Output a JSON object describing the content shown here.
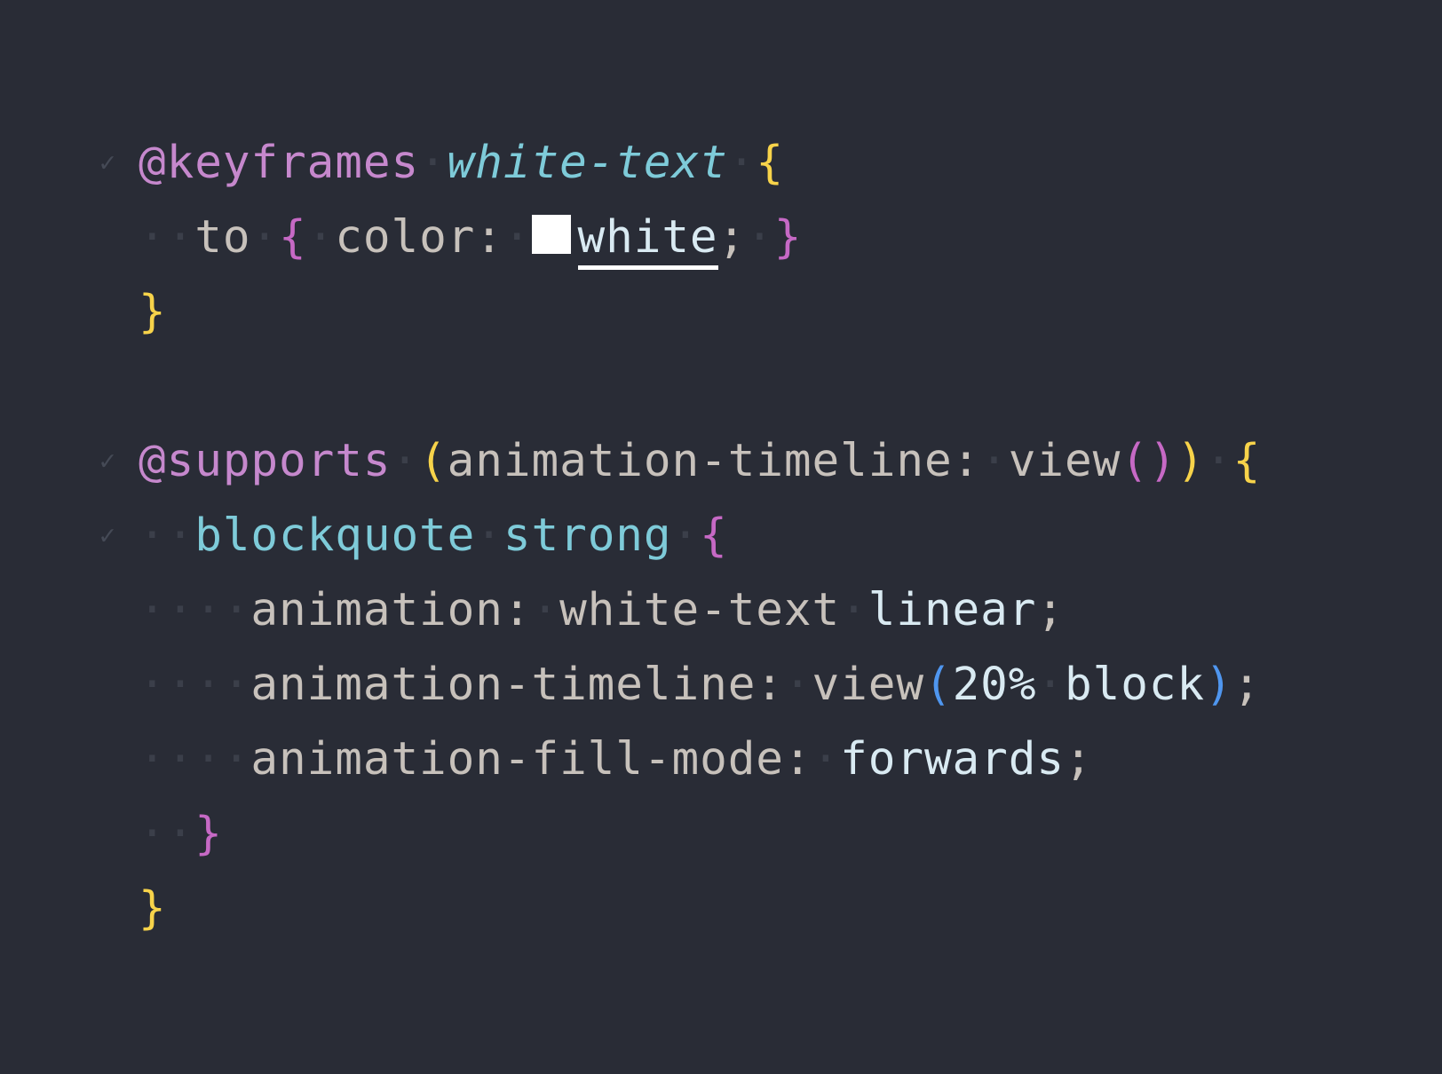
{
  "colors": {
    "background": "#292c36",
    "at_rule": "#c688cd",
    "name": "#7ecbd9",
    "brace_outer": "#f7d34a",
    "brace_inner": "#c669c5",
    "paren_blue": "#4f96ef",
    "property": "#c7c1bb",
    "value": "#d9eaf2",
    "punct": "#c7c1bb",
    "whitespace_marker": "#3b3f4a",
    "swatch": "#ffffff"
  },
  "icons": {
    "fold": "fold-check-icon",
    "swatch": "color-swatch-icon"
  },
  "lines": [
    {
      "fold": true,
      "tokens": [
        {
          "t": "@keyframes",
          "c": "at_rule"
        },
        {
          "t": "·",
          "c": "whitespace_marker"
        },
        {
          "t": "white-text",
          "c": "name",
          "italic": true
        },
        {
          "t": "·",
          "c": "whitespace_marker"
        },
        {
          "t": "{",
          "c": "brace_outer"
        }
      ]
    },
    {
      "fold": false,
      "tokens": [
        {
          "t": "··",
          "c": "whitespace_marker"
        },
        {
          "t": "to",
          "c": "property"
        },
        {
          "t": "·",
          "c": "whitespace_marker"
        },
        {
          "t": "{",
          "c": "brace_inner"
        },
        {
          "t": "·",
          "c": "whitespace_marker"
        },
        {
          "t": "color:",
          "c": "property"
        },
        {
          "t": "·",
          "c": "whitespace_marker"
        },
        {
          "swatch": true
        },
        {
          "t": "white",
          "c": "value",
          "underline": true
        },
        {
          "t": ";",
          "c": "punct"
        },
        {
          "t": "·",
          "c": "whitespace_marker"
        },
        {
          "t": "}",
          "c": "brace_inner"
        }
      ]
    },
    {
      "fold": false,
      "tokens": [
        {
          "t": "}",
          "c": "brace_outer"
        }
      ]
    },
    {
      "fold": false,
      "tokens": []
    },
    {
      "fold": true,
      "tokens": [
        {
          "t": "@supports",
          "c": "at_rule"
        },
        {
          "t": "·",
          "c": "whitespace_marker"
        },
        {
          "t": "(",
          "c": "brace_outer"
        },
        {
          "t": "animation-timeline:",
          "c": "property"
        },
        {
          "t": "·",
          "c": "whitespace_marker"
        },
        {
          "t": "view",
          "c": "property"
        },
        {
          "t": "()",
          "c": "brace_inner"
        },
        {
          "t": ")",
          "c": "brace_outer"
        },
        {
          "t": "·",
          "c": "whitespace_marker"
        },
        {
          "t": "{",
          "c": "brace_outer"
        }
      ]
    },
    {
      "fold": true,
      "tokens": [
        {
          "t": "··",
          "c": "whitespace_marker"
        },
        {
          "t": "blockquote",
          "c": "name"
        },
        {
          "t": "·",
          "c": "whitespace_marker"
        },
        {
          "t": "strong",
          "c": "name"
        },
        {
          "t": "·",
          "c": "whitespace_marker"
        },
        {
          "t": "{",
          "c": "brace_inner"
        }
      ]
    },
    {
      "fold": false,
      "tokens": [
        {
          "t": "····",
          "c": "whitespace_marker"
        },
        {
          "t": "animation:",
          "c": "property"
        },
        {
          "t": "·",
          "c": "whitespace_marker"
        },
        {
          "t": "white-text",
          "c": "property"
        },
        {
          "t": "·",
          "c": "whitespace_marker"
        },
        {
          "t": "linear",
          "c": "value"
        },
        {
          "t": ";",
          "c": "punct"
        }
      ]
    },
    {
      "fold": false,
      "tokens": [
        {
          "t": "····",
          "c": "whitespace_marker"
        },
        {
          "t": "animation-timeline:",
          "c": "property"
        },
        {
          "t": "·",
          "c": "whitespace_marker"
        },
        {
          "t": "view",
          "c": "property"
        },
        {
          "t": "(",
          "c": "paren_blue"
        },
        {
          "t": "20%",
          "c": "value"
        },
        {
          "t": "·",
          "c": "whitespace_marker"
        },
        {
          "t": "block",
          "c": "value"
        },
        {
          "t": ")",
          "c": "paren_blue"
        },
        {
          "t": ";",
          "c": "punct"
        }
      ]
    },
    {
      "fold": false,
      "tokens": [
        {
          "t": "····",
          "c": "whitespace_marker"
        },
        {
          "t": "animation-fill-mode:",
          "c": "property"
        },
        {
          "t": "·",
          "c": "whitespace_marker"
        },
        {
          "t": "forwards",
          "c": "value"
        },
        {
          "t": ";",
          "c": "punct"
        }
      ]
    },
    {
      "fold": false,
      "tokens": [
        {
          "t": "··",
          "c": "whitespace_marker"
        },
        {
          "t": "}",
          "c": "brace_inner"
        }
      ]
    },
    {
      "fold": false,
      "tokens": [
        {
          "t": "}",
          "c": "brace_outer"
        }
      ]
    }
  ]
}
